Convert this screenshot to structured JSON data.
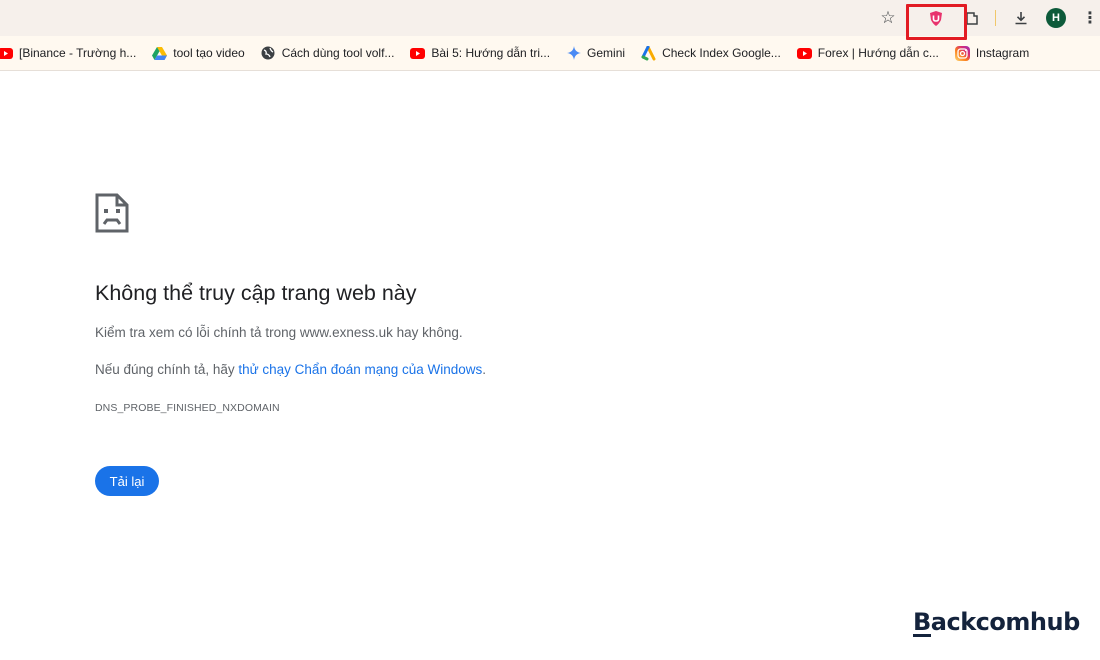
{
  "toolbar": {
    "icons": [
      "star-icon",
      "shield-extension-icon",
      "puzzle-extension-icon",
      "download-icon",
      "more-menu-icon"
    ],
    "avatar_letter": "H"
  },
  "bookmarks": [
    {
      "label": "[Binance - Trường h...",
      "icon": "youtube-icon"
    },
    {
      "label": "tool tạo video",
      "icon": "google-drive-icon"
    },
    {
      "label": "Cách dùng tool volf...",
      "icon": "globe-icon"
    },
    {
      "label": "Bài 5: Hướng dẫn tri...",
      "icon": "youtube-icon"
    },
    {
      "label": "Gemini",
      "icon": "gemini-icon"
    },
    {
      "label": "Check Index Google...",
      "icon": "apps-script-icon"
    },
    {
      "label": "Forex | Hướng dẫn c...",
      "icon": "youtube-icon"
    },
    {
      "label": "Instagram",
      "icon": "instagram-icon"
    }
  ],
  "error": {
    "icon": "sad-page-icon",
    "title": "Không thể truy cập trang web này",
    "line1": "Kiểm tra xem có lỗi chính tả trong www.exness.uk hay không.",
    "line2_prefix": "Nếu đúng chính tả, hãy ",
    "line2_link": "thử chạy Chẩn đoán mạng của Windows",
    "line2_suffix": ".",
    "code": "DNS_PROBE_FINISHED_NXDOMAIN",
    "reload_label": "Tải lại"
  },
  "watermark": "Backcomhub",
  "colors": {
    "accent": "#1a73e8",
    "highlight_box": "#e21b23",
    "toolbar_bg": "#f6f0eb",
    "bookmarks_bg": "#fff9f0",
    "youtube": "#ff0000",
    "avatar_bg": "#0d5a3a",
    "watermark": "#14233c"
  }
}
